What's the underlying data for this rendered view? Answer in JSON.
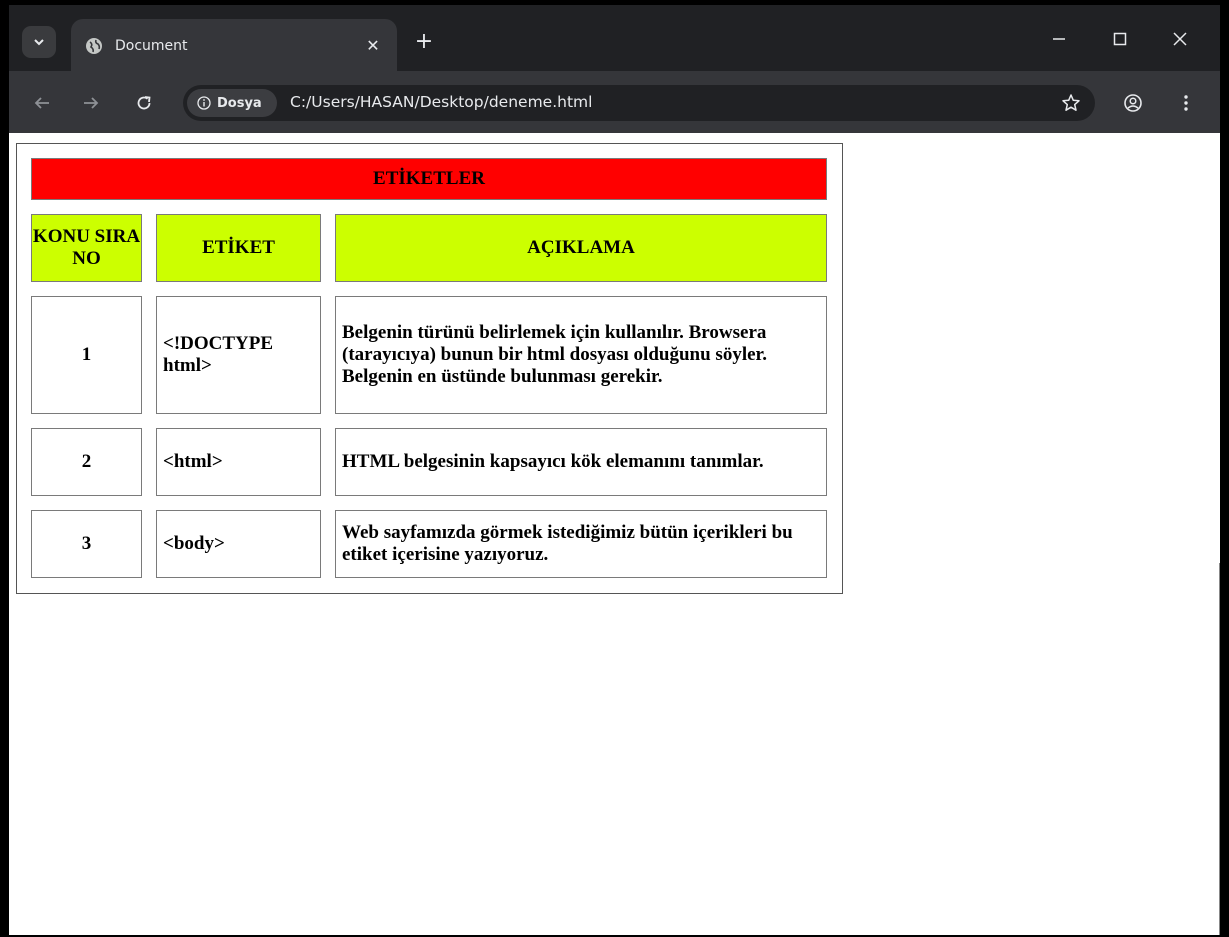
{
  "browser": {
    "tab": {
      "title": "Document"
    },
    "address": {
      "security_chip": "Dosya",
      "url": "C:/Users/HASAN/Desktop/deneme.html"
    },
    "icons": [
      "tab-search-icon",
      "globe-icon",
      "close-icon",
      "plus-icon",
      "minimize-icon",
      "maximize-icon",
      "close-window-icon",
      "back-icon",
      "forward-icon",
      "reload-icon",
      "info-icon",
      "star-icon",
      "profile-icon",
      "kebab-menu-icon"
    ]
  },
  "table": {
    "title": "ETİKETLER",
    "headers": {
      "no": "KONU SIRA NO",
      "tag": "ETİKET",
      "desc": "AÇIKLAMA"
    },
    "rows": [
      {
        "no": "1",
        "tag": "<!DOCTYPE html>",
        "desc": "Belgenin türünü belirlemek için kullanılır. Browsera (tarayıcıya) bunun bir html dosyası olduğunu söyler. Belgenin en üstünde bulunması gerekir."
      },
      {
        "no": "2",
        "tag": "<html>",
        "desc": "HTML belgesinin kapsayıcı kök elemanını tanımlar."
      },
      {
        "no": "3",
        "tag": "<body>",
        "desc": "Web sayfamızda görmek istediğimiz bütün içerikleri bu etiket içerisine yazıyoruz."
      }
    ],
    "colors": {
      "title_bg": "#ff0000",
      "header_bg": "#ccff00"
    }
  }
}
